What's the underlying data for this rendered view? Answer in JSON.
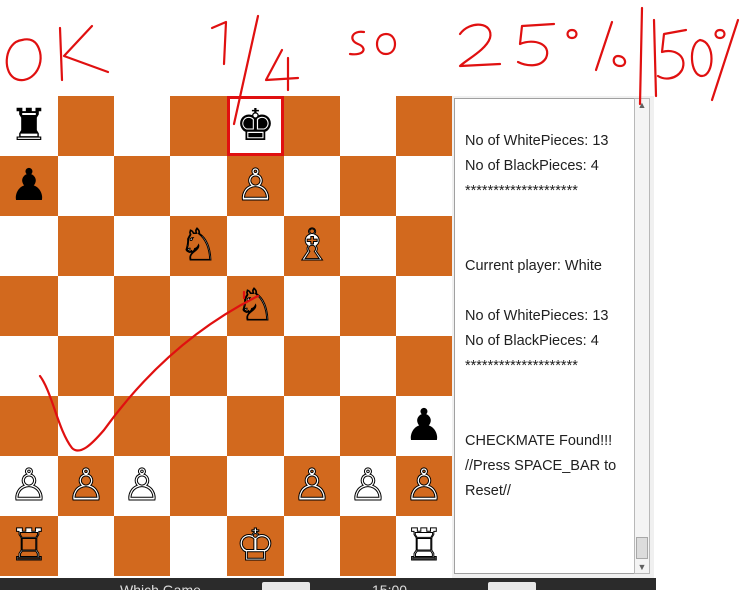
{
  "board": {
    "selected_square": "e8",
    "rows": [
      [
        "♜",
        "",
        "",
        "",
        "♚",
        "",
        "",
        ""
      ],
      [
        "♟",
        "",
        "",
        "",
        "♙",
        "",
        "",
        ""
      ],
      [
        "",
        "",
        "",
        "♘",
        "",
        "♗",
        "",
        ""
      ],
      [
        "",
        "",
        "",
        "",
        "♘",
        "",
        "",
        ""
      ],
      [
        "",
        "",
        "",
        "",
        "",
        "",
        "",
        ""
      ],
      [
        "",
        "",
        "",
        "",
        "",
        "",
        "",
        "♟"
      ],
      [
        "♙",
        "♙",
        "♙",
        "",
        "",
        "♙",
        "♙",
        "♙"
      ],
      [
        "♖",
        "",
        "",
        "",
        "♔",
        "",
        "",
        "♖"
      ]
    ],
    "colors": {
      "light": "#ffffff",
      "dark": "#d2691e",
      "highlight": "#e01010"
    }
  },
  "log": {
    "lines": [
      "No of WhitePieces: 13",
      "No of BlackPieces: 4",
      "********************",
      "",
      "",
      "Current player: White",
      "",
      "No of WhitePieces: 13",
      "No of BlackPieces: 4",
      "********************",
      "",
      "",
      "CHECKMATE Found!!!",
      "//Press SPACE_BAR to",
      "Reset//"
    ]
  },
  "bottom": {
    "left_label": "Which Game",
    "clock": "15:00"
  },
  "annotations": {
    "color": "#e01010",
    "texts": [
      "OK",
      "1/4",
      "so",
      "25%",
      "50%"
    ]
  }
}
